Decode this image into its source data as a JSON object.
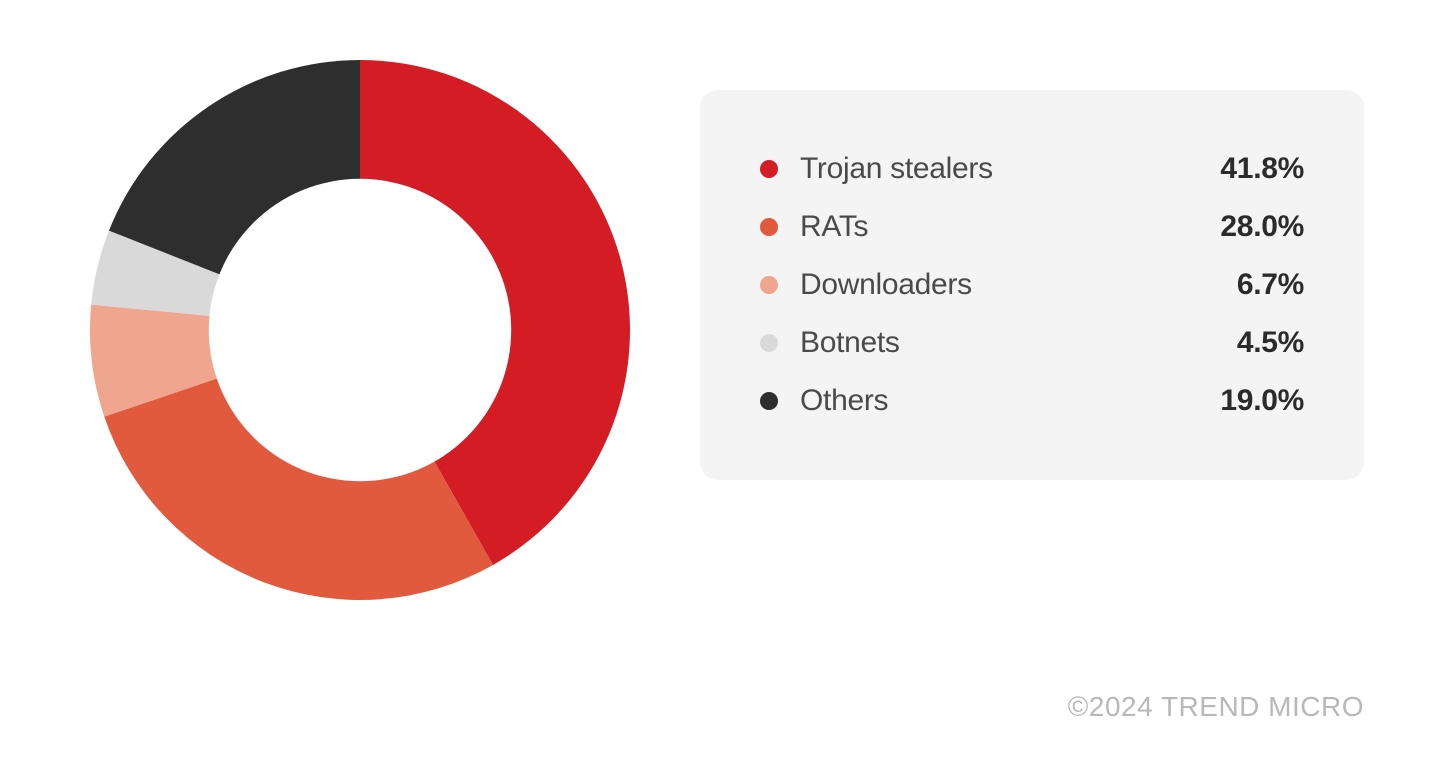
{
  "chart_data": {
    "type": "pie",
    "series": [
      {
        "name": "Trojan stealers",
        "value": 41.8,
        "color": "#d31c23",
        "display": "41.8%"
      },
      {
        "name": "RATs",
        "value": 28.0,
        "color": "#e25a3d",
        "display": "28.0%"
      },
      {
        "name": "Downloaders",
        "value": 6.7,
        "color": "#f0a58f",
        "display": "6.7%"
      },
      {
        "name": "Botnets",
        "value": 4.5,
        "color": "#d9d9d9",
        "display": "4.5%"
      },
      {
        "name": "Others",
        "value": 19.0,
        "color": "#2e2e2e",
        "display": "19.0%"
      }
    ],
    "donut_inner_ratio": 0.56,
    "start_angle_deg": -90
  },
  "copyright": "©2024 TREND MICRO"
}
